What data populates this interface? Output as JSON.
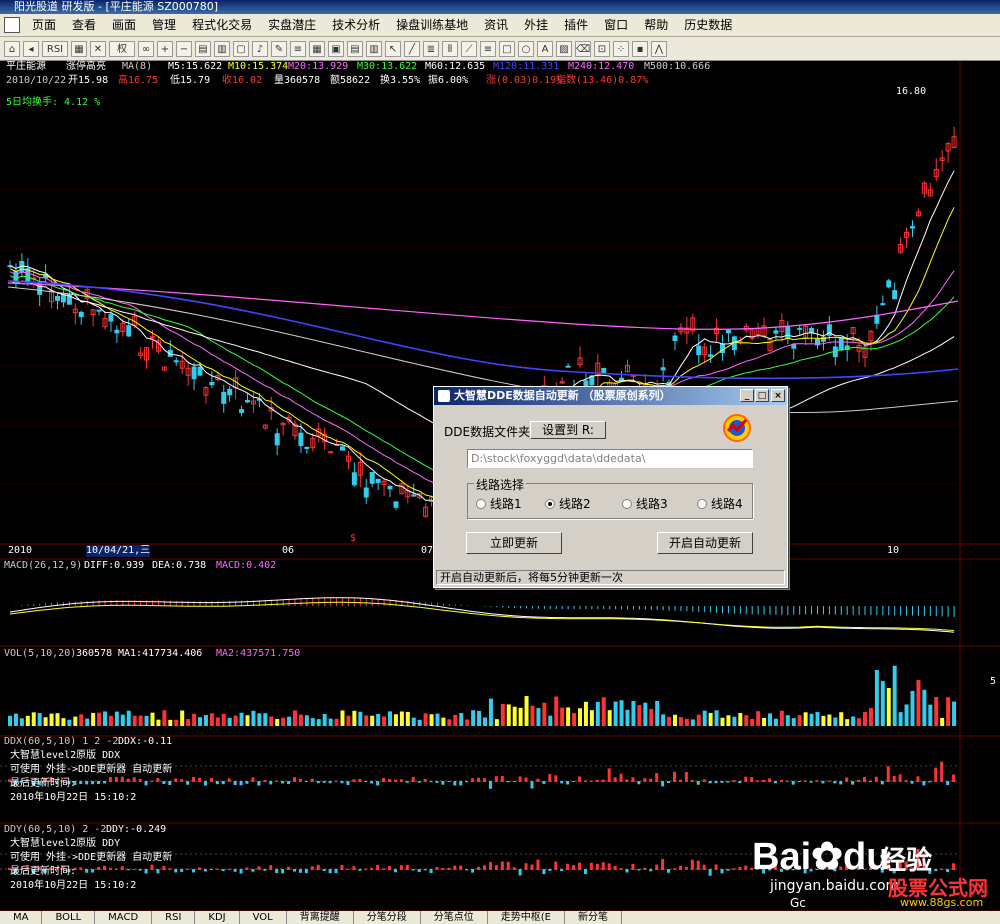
{
  "window": {
    "title": "阳光股道 研发版 - [平庄能源 SZ000780]"
  },
  "menu": [
    "页面",
    "查看",
    "画面",
    "管理",
    "程式化交易",
    "实盘潜庄",
    "技术分析",
    "操盘训练基地",
    "资讯",
    "外挂",
    "插件",
    "窗口",
    "帮助",
    "历史数据"
  ],
  "toolbar": {
    "items": [
      "RSI",
      "权"
    ]
  },
  "stock": {
    "name": "平庄能源",
    "label": "涨停高亮",
    "ma_header": "MA(8)",
    "ma5": "M5:15.622",
    "ma10": "M10:15.374",
    "ma20": "M20:13.929",
    "ma30": "M30:13.622",
    "ma60": "M60:12.635",
    "ma120": "M120:11.331",
    "ma240": "M240:12.470",
    "ma500": "M500:10.666",
    "date": "2010/10/22",
    "open": "开15.98",
    "high": "高16.75",
    "low": "低15.79",
    "close": "收16.02",
    "volume": "量360578",
    "amount": "额58622",
    "turnover": "换3.55%",
    "amplitude": "振6.00%",
    "change": "涨(0.03)0.19%",
    "index": "指数(13.46)0.87%",
    "avg_turnover": "5日均换手: 4.12 %",
    "high_price_label": "16.80"
  },
  "colors": {
    "up": "#ff3333",
    "down": "#33ccee",
    "yellow": "#ffff33",
    "ma5": "#ffffff",
    "ma10": "#ffff00",
    "ma20": "#ff66ff",
    "ma30": "#33ff33",
    "ma60": "#ffffff",
    "ma120": "#4444ff",
    "ma240": "#ff66ff",
    "ma500": "#cccccc"
  },
  "xaxis": {
    "labels": [
      "2010",
      "10/04/21,三",
      "06",
      "07",
      "10"
    ],
    "marker": "$"
  },
  "macd": {
    "header": "MACD(26,12,9)",
    "diff": "DIFF:0.939",
    "dea": "DEA:0.738",
    "macd": "MACD:0.402"
  },
  "vol": {
    "header": "VOL(5,10,20)",
    "vol": "360578",
    "ma1": "MA1:417734.406",
    "ma2": "MA2:437571.750",
    "right": "5"
  },
  "ddx": {
    "header": "DDX(60,5,10) 1 2 -2",
    "value": "DDX:-0.11",
    "line1": "大智慧level2原版 DDX",
    "line2": "可使用 外挂->DDE更新器 自动更新",
    "line3": "最后更新时间:",
    "line4": "2010年10月22日 15:10:2"
  },
  "ddy": {
    "header": "DDY(60,5,10) 2 -2",
    "value": "DDY:-0.249",
    "line1": "大智慧level2原版 DDY",
    "line2": "可使用 外挂->DDE更新器 自动更新",
    "line3": "最后更新时间:",
    "line4": "2010年10月22日 15:10:2"
  },
  "bottom_tabs": [
    "MA",
    "BOLL",
    "MACD",
    "RSI",
    "KDJ",
    "VOL",
    "背离提醒",
    "分笔分段",
    "分笔点位",
    "走势中枢(E",
    "新分笔"
  ],
  "dialog": {
    "title": "大智慧DDE数据自动更新 （股票原创系列）",
    "folder_label": "DDE数据文件夹:",
    "set_button": "设置到 R:",
    "path_value": "D:\\stock\\foxyggd\\data\\ddedata\\",
    "group_label": "线路选择",
    "routes": [
      "线路1",
      "线路2",
      "线路3",
      "线路4"
    ],
    "selected_route": 1,
    "update_now": "立即更新",
    "auto_update": "开启自动更新",
    "status": "开启自动更新后，将每5分钟更新一次",
    "min": "_",
    "max": "□",
    "close": "×"
  },
  "watermark": {
    "brand": "Bai",
    "brand2": "du",
    "jy": "经验",
    "url": "jingyan.baidu.com",
    "site": "www.88gs.com",
    "site_label": "股票公式网",
    "gc": "Gc"
  }
}
